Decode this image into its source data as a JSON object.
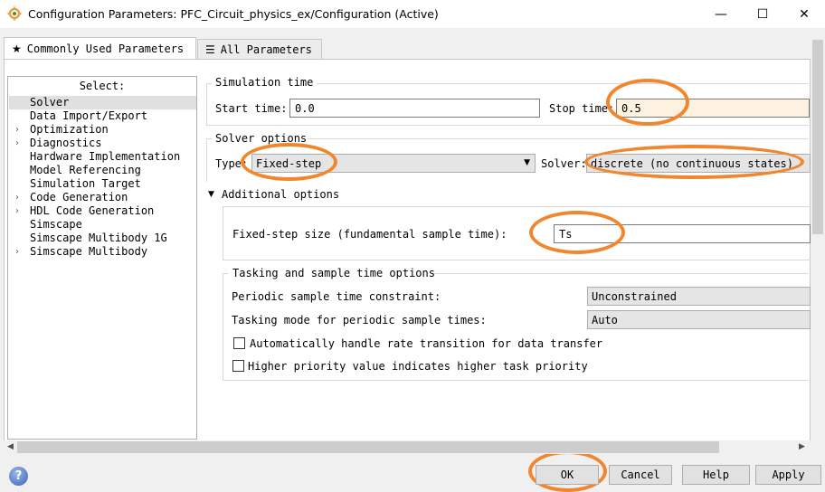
{
  "window": {
    "title": "Configuration Parameters: PFC_Circuit_physics_ex/Configuration (Active)",
    "minimize": "—",
    "maximize": "☐",
    "close": "✕"
  },
  "tabs": [
    {
      "label": "Commonly Used Parameters",
      "icon": "star-icon",
      "glyph": "★"
    },
    {
      "label": "All Parameters",
      "icon": "table-icon",
      "glyph": "☰"
    }
  ],
  "sidebar": {
    "title": "Select:",
    "items": [
      {
        "label": "Solver",
        "expandable": false,
        "selected": true
      },
      {
        "label": "Data Import/Export",
        "expandable": false
      },
      {
        "label": "Optimization",
        "expandable": true
      },
      {
        "label": "Diagnostics",
        "expandable": true
      },
      {
        "label": "Hardware Implementation",
        "expandable": false
      },
      {
        "label": "Model Referencing",
        "expandable": false
      },
      {
        "label": "Simulation Target",
        "expandable": false
      },
      {
        "label": "Code Generation",
        "expandable": true
      },
      {
        "label": "HDL Code Generation",
        "expandable": true
      },
      {
        "label": "Simscape",
        "expandable": false
      },
      {
        "label": "Simscape Multibody 1G",
        "expandable": false
      },
      {
        "label": "Simscape Multibody",
        "expandable": true
      }
    ],
    "expand_glyph": "›"
  },
  "simulation_time": {
    "heading": "Simulation time",
    "start_label": "Start time:",
    "start_value": "0.0",
    "stop_label": "Stop time:",
    "stop_value": "0.5"
  },
  "solver_options": {
    "heading": "Solver options",
    "type_label": "Type:",
    "type_value": "Fixed-step",
    "solver_label": "Solver:",
    "solver_value": "discrete (no continuous states)"
  },
  "additional_options": {
    "heading": "Additional options",
    "toggle_glyph": "▼",
    "step_size_label": "Fixed-step size (fundamental sample time):",
    "step_size_value": "Ts"
  },
  "tasking": {
    "heading": "Tasking and sample time options",
    "periodic_label": "Periodic sample time constraint:",
    "periodic_value": "Unconstrained",
    "tasking_label": "Tasking mode for periodic sample times:",
    "tasking_value": "Auto",
    "auto_rate_label": "Automatically handle rate transition for data transfer",
    "auto_rate_checked": false,
    "priority_label": "Higher priority value indicates higher task priority",
    "priority_checked": false
  },
  "footer": {
    "help_glyph": "?",
    "ok": "OK",
    "cancel": "Cancel",
    "help": "Help",
    "apply": "Apply"
  },
  "accent": "#f0872e"
}
